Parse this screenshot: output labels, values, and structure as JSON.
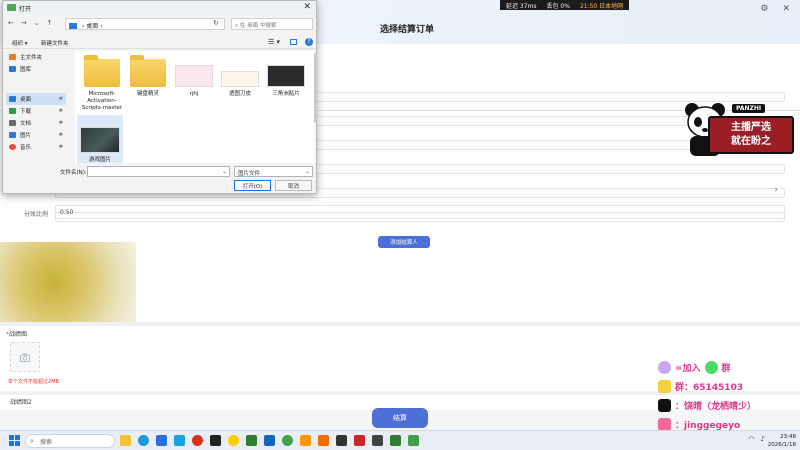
{
  "app": {
    "title": "选择结算订单",
    "ratio_label": "分账比例",
    "ratio_value": "0.50",
    "add_button": "添加结算人",
    "screenshot_label": "战绩图",
    "screenshot_required_mark": "*",
    "upload_hint": "单个文件不能超过2MB",
    "screenshot2_label": "战绩图2",
    "settle_button": "结算"
  },
  "stream_status": {
    "latency": "延迟 37ms",
    "loss": "丢包 0%",
    "net": "21:50 日本地网"
  },
  "overlay": {
    "panda_tag": "PANZHI",
    "promo_line1": "主播严选",
    "promo_line2": "就在盼之",
    "social": {
      "join_text": "=加入",
      "join_suffix": "群",
      "qq": "群：65145103",
      "tiktok": "：饶晴（龙栖晴少）",
      "bili": "：jinggegeyo"
    }
  },
  "dialog": {
    "title": "打开",
    "address": "桌面",
    "address_sep": "›",
    "search_placeholder": "在 桌面 中搜索",
    "organize": "组织 ▾",
    "new_folder": "新建文件夹",
    "view_icon": "☰ ▾",
    "help": "?",
    "nav_items": [
      {
        "label": "主文件夹",
        "color": "#e67e22"
      },
      {
        "label": "图库",
        "color": "#2a7ad6"
      },
      {
        "label": "桌面",
        "color": "#2a7ad6"
      },
      {
        "label": "下载",
        "color": "#2a9d4a"
      },
      {
        "label": "文档",
        "color": "#6b6b6b"
      },
      {
        "label": "图片",
        "color": "#2a7ad6"
      },
      {
        "label": "音乐",
        "color": "#e74c3c"
      }
    ],
    "files": [
      {
        "name": "Microsoft-Activation-Scripts-master"
      },
      {
        "name": "键盘精灵"
      },
      {
        "name": "rjhj"
      },
      {
        "name": "透图刀皮"
      },
      {
        "name": "三角洲贴片"
      },
      {
        "name": "游戏图片"
      }
    ],
    "filename_label": "文件名(N):",
    "filetype": "图片文件",
    "open_button": "打开(O)",
    "cancel_button": "取消"
  },
  "taskbar": {
    "search_placeholder": "搜索",
    "time": "23:48",
    "date": "2026/1/18"
  },
  "colors": {
    "accent": "#4d6fd8",
    "required": "#e33333",
    "dialog_selection": "#cde0f7"
  }
}
